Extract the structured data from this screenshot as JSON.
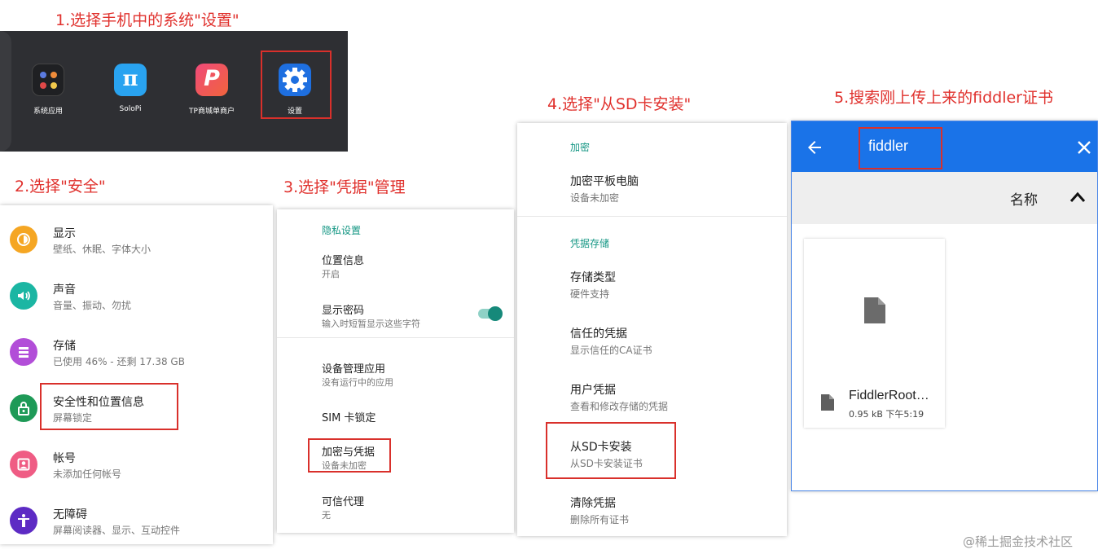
{
  "steps": {
    "s1": "1.选择手机中的系统\"设置\"",
    "s2": "2.选择\"安全\"",
    "s3": "3.选择\"凭据\"管理",
    "s4": "4.选择\"从SD卡安装\"",
    "s5": "5.搜索刚上传上来的fiddler证书"
  },
  "launcher": {
    "apps": [
      {
        "label": "系统应用",
        "icon": "app-folder-icon"
      },
      {
        "label": "SoloPi",
        "icon": "solopi-icon"
      },
      {
        "label": "TP商城单商户",
        "icon": "tp-icon"
      },
      {
        "label": "设置",
        "icon": "settings-gear-icon"
      }
    ],
    "solopi_glyph": "π",
    "tp_glyph": "P"
  },
  "settings": {
    "items": [
      {
        "title": "显示",
        "subtitle": "壁纸、休眠、字体大小",
        "icon": "display-icon",
        "color": "#f5a623"
      },
      {
        "title": "声音",
        "subtitle": "音量、振动、勿扰",
        "icon": "sound-icon",
        "color": "#1bb6a3"
      },
      {
        "title": "存储",
        "subtitle": "已使用 46% - 还剩 17.38 GB",
        "icon": "storage-icon",
        "color": "#b24ed8"
      },
      {
        "title": "安全性和位置信息",
        "subtitle": "屏幕锁定",
        "icon": "lock-icon",
        "color": "#1e9a57"
      },
      {
        "title": "帐号",
        "subtitle": "未添加任何帐号",
        "icon": "account-icon",
        "color": "#ef5c84"
      },
      {
        "title": "无障碍",
        "subtitle": "屏幕阅读器、显示、互动控件",
        "icon": "accessibility-icon",
        "color": "#5d2bc4"
      }
    ]
  },
  "security": {
    "section_privacy": "隐私设置",
    "location_title": "位置信息",
    "location_sub": "开启",
    "showpw_title": "显示密码",
    "showpw_sub": "输入时短暂显示这些字符",
    "devadmin_title": "设备管理应用",
    "devadmin_sub": "没有运行中的应用",
    "sim_title": "SIM 卡锁定",
    "enc_title": "加密与凭据",
    "enc_sub": "设备未加密",
    "trust_title": "可信代理",
    "trust_sub": "无"
  },
  "credentials": {
    "section_enc": "加密",
    "enc_tablet_title": "加密平板电脑",
    "enc_tablet_sub": "设备未加密",
    "section_store": "凭据存储",
    "type_title": "存储类型",
    "type_sub": "硬件支持",
    "trusted_title": "信任的凭据",
    "trusted_sub": "显示信任的CA证书",
    "user_title": "用户凭据",
    "user_sub": "查看和修改存储的凭据",
    "install_title": "从SD卡安装",
    "install_sub": "从SD卡安装证书",
    "clear_title": "清除凭据",
    "clear_sub": "删除所有证书"
  },
  "filepicker": {
    "search_value": "fiddler",
    "sort_label": "名称",
    "file_name": "FiddlerRoot…",
    "file_meta": "0.95 kB 下午5:19",
    "accent": "#1a73e8"
  },
  "watermark": "@稀土掘金技术社区"
}
